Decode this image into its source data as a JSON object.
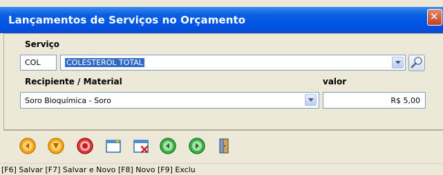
{
  "window": {
    "title": "Lançamentos de Serviços no Orçamento",
    "close_glyph": "✕"
  },
  "servico": {
    "label": "Serviço",
    "code": "COL",
    "description": "COLESTEROL TOTAL"
  },
  "recipiente": {
    "label": "Recipiente / Material",
    "value": "Soro Bioquímica - Soro"
  },
  "valor": {
    "label": "valor",
    "value": "R$ 5,00"
  },
  "toolbar": {
    "icons": [
      "first-icon",
      "previous-icon",
      "stop-icon",
      "new-record-icon",
      "delete-record-icon",
      "next-icon",
      "last-icon",
      "exit-door-icon"
    ]
  },
  "statusbar": {
    "text": "[F6] Salvar [F7] Salvar e Novo [F8] Novo [F9] Exclu"
  },
  "colors": {
    "title_bar": "#0054e3",
    "selection": "#316ac5",
    "window_bg": "#ece9d8"
  }
}
